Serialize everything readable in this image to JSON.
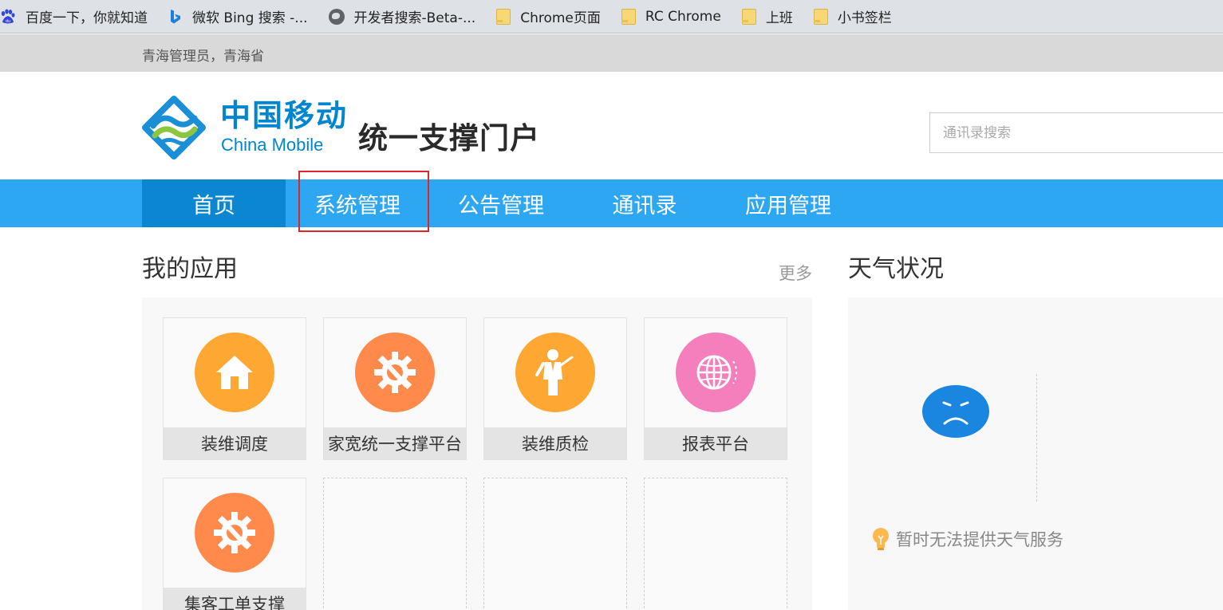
{
  "bookmarks": [
    {
      "label": "百度一下，你就知道",
      "icon": "baidu-icon"
    },
    {
      "label": "微软 Bing 搜索 -...",
      "icon": "bing-icon"
    },
    {
      "label": "开发者搜索-Beta-...",
      "icon": "globe-icon"
    },
    {
      "label": "Chrome页面",
      "icon": "folder-icon"
    },
    {
      "label": "RC Chrome",
      "icon": "folder-icon"
    },
    {
      "label": "上班",
      "icon": "folder-icon"
    },
    {
      "label": "小书签栏",
      "icon": "folder-icon"
    }
  ],
  "user": {
    "info": "青海管理员，青海省"
  },
  "header": {
    "brand_cn": "中国移动",
    "brand_en": "China Mobile",
    "portal_title": "统一支撑门户",
    "search_placeholder": "通讯录搜索"
  },
  "nav": {
    "items": [
      {
        "label": "首页",
        "active": true
      },
      {
        "label": "系统管理",
        "active": false,
        "highlighted": true
      },
      {
        "label": "公告管理",
        "active": false
      },
      {
        "label": "通讯录",
        "active": false
      },
      {
        "label": "应用管理",
        "active": false
      }
    ]
  },
  "my_apps": {
    "title": "我的应用",
    "more": "更多",
    "apps": [
      {
        "label": "装维调度",
        "icon": "home-icon",
        "color": "#ffa733"
      },
      {
        "label": "家宽统一支撑平台",
        "icon": "gear-wrench-icon",
        "color": "#ff8a4c"
      },
      {
        "label": "装维质检",
        "icon": "presenter-icon",
        "color": "#ffa733"
      },
      {
        "label": "报表平台",
        "icon": "globe-icon",
        "color": "#f57fbd"
      },
      {
        "label": "集客工单支撑",
        "icon": "gear-wrench-icon",
        "color": "#ff8a4c"
      }
    ]
  },
  "weather": {
    "title": "天气状况",
    "message": "暂时无法提供天气服务",
    "face_color": "#1a86e0",
    "bulb_color": "#ffb84d"
  },
  "colors": {
    "nav_bg": "#2ea7f3",
    "nav_active_bg": "#0b86d0",
    "brand_blue": "#0086d1",
    "highlight_red": "#e0252b"
  }
}
